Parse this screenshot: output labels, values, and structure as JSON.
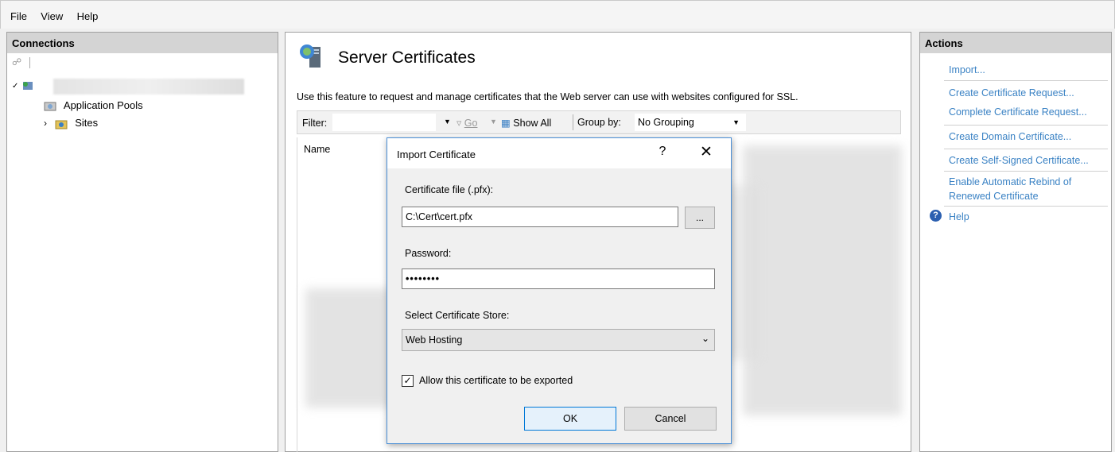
{
  "menu": {
    "file": "File",
    "view": "View",
    "help": "Help"
  },
  "connections": {
    "header": "Connections",
    "tree": {
      "app_pools": "Application Pools",
      "sites": "Sites"
    }
  },
  "center": {
    "title": "Server Certificates",
    "description": "Use this feature to request and manage certificates that the Web server can use with websites configured for SSL.",
    "filter": {
      "label": "Filter:",
      "go": "Go",
      "show_all": "Show All",
      "group_by_label": "Group by:",
      "group_by_value": "No Grouping"
    },
    "column_name": "Name"
  },
  "actions": {
    "header": "Actions",
    "items": [
      "Import...",
      "Create Certificate Request...",
      "Complete Certificate Request...",
      "Create Domain Certificate...",
      "Create Self-Signed Certificate...",
      "Enable Automatic Rebind of",
      "Renewed Certificate"
    ],
    "help": "Help"
  },
  "dialog": {
    "title": "Import Certificate",
    "help_glyph": "?",
    "close_glyph": "✕",
    "file_label": "Certificate file (.pfx):",
    "file_value": "C:\\Cert\\cert.pfx",
    "browse": "...",
    "password_label": "Password:",
    "password_value": "••••••••",
    "store_label": "Select Certificate Store:",
    "store_value": "Web Hosting",
    "allow_export_label": "Allow this certificate to be exported",
    "ok": "OK",
    "cancel": "Cancel"
  },
  "colors": {
    "link": "#3a82c4",
    "header_bg": "#d4d4d4",
    "dialog_border": "#4a8fd6"
  }
}
